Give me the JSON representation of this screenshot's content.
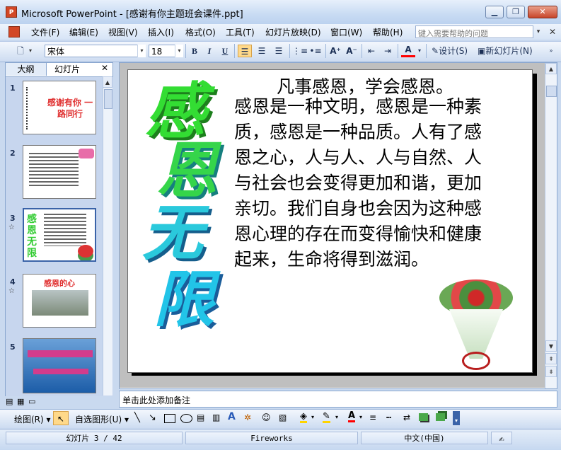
{
  "window": {
    "app_icon_label": "P",
    "title": "Microsoft PowerPoint - [感谢有你主题班会课件.ppt]",
    "minimize": "▁",
    "restore": "❐",
    "close": "✕"
  },
  "menubar": {
    "items": [
      "文件(F)",
      "编辑(E)",
      "视图(V)",
      "插入(I)",
      "格式(O)",
      "工具(T)",
      "幻灯片放映(D)",
      "窗口(W)",
      "帮助(H)"
    ],
    "help_placeholder": "键入需要帮助的问题",
    "help_dropdown": "▾",
    "doc_close": "✕"
  },
  "toolbar": {
    "new_icon": "🗋",
    "font_name": "宋体",
    "font_size": "18",
    "bold": "B",
    "italic": "I",
    "underline": "U",
    "grow_font": "A⁺",
    "shrink_font": "A⁻",
    "font_color": "A",
    "design_label": "设计(S)",
    "new_slide_label": "新幻灯片(N)"
  },
  "outline_pane": {
    "tab_outline": "大纲",
    "tab_slides": "幻灯片",
    "close": "✕",
    "slides": [
      {
        "num": "1",
        "text": "感谢有你 一路同行"
      },
      {
        "num": "2",
        "text": ""
      },
      {
        "num": "3",
        "text": "感恩无限"
      },
      {
        "num": "4",
        "text": "感恩的心"
      },
      {
        "num": "5",
        "text": ""
      }
    ],
    "star": "☆"
  },
  "slide": {
    "vertical_title": [
      "感",
      "恩",
      "无",
      "限"
    ],
    "title": "凡事感恩，学会感恩。",
    "body": "感恩是一种文明，感恩是一种素质，感恩是一种品质。人有了感恩之心，人与人、人与自然、人与社会也会变得更加和谐，更加亲切。我们自身也会因为这种感恩心理的存在而变得愉快和健康起来，生命将得到滋润。"
  },
  "notes": {
    "placeholder": "单击此处添加备注"
  },
  "drawbar": {
    "draw_label": "绘图(R)",
    "autoshapes_label": "自选图形(U)"
  },
  "statusbar": {
    "slide_pos": "幻灯片 3 / 42",
    "design": "Fireworks",
    "language": "中文(中国)"
  },
  "colors": {
    "title_green": "#33dd33",
    "title_cyan": "#22c4e8",
    "accent": "#ffd98a"
  }
}
